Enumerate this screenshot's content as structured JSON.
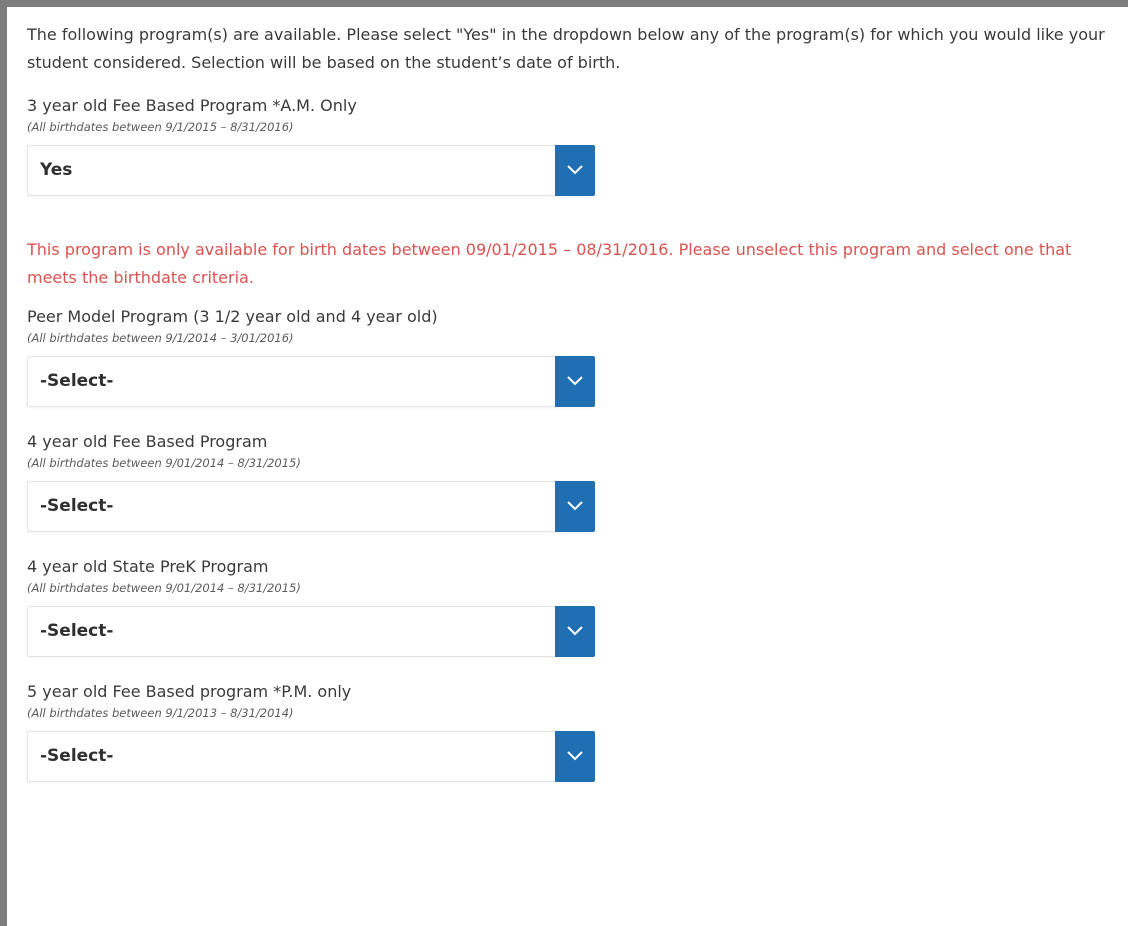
{
  "intro_text": "The following program(s) are available. Please select \"Yes\" in the dropdown below any of the program(s) for which you would like your student considered. Selection will be based on the student’s date of birth.",
  "programs": [
    {
      "label": "3 year old Fee Based Program *A.M. Only",
      "note": "(All birthdates between 9/1/2015 – 8/31/2016)",
      "selected_value": "Yes"
    },
    {
      "label": "Peer Model Program (3 1/2 year old and 4 year old)",
      "note": "(All birthdates between 9/1/2014 – 3/01/2016)",
      "selected_value": "-Select-"
    },
    {
      "label": "4 year old Fee Based Program",
      "note": "(All birthdates between 9/01/2014 – 8/31/2015)",
      "selected_value": "-Select-"
    },
    {
      "label": "4 year old State PreK Program",
      "note": "(All birthdates between 9/01/2014 – 8/31/2015)",
      "selected_value": "-Select-"
    },
    {
      "label": "5 year old Fee Based program *P.M. only",
      "note": "(All birthdates between 9/1/2013 – 8/31/2014)",
      "selected_value": "-Select-"
    }
  ],
  "error_message": "This program is only available for birth dates between 09/01/2015 – 08/31/2016. Please unselect this program and select one that meets the birthdate criteria.",
  "colors": {
    "accent": "#1f6fb2",
    "error": "#d9534f",
    "frame": "#7d7d7d"
  },
  "icons": {
    "dropdown": "chevron-down-icon"
  }
}
